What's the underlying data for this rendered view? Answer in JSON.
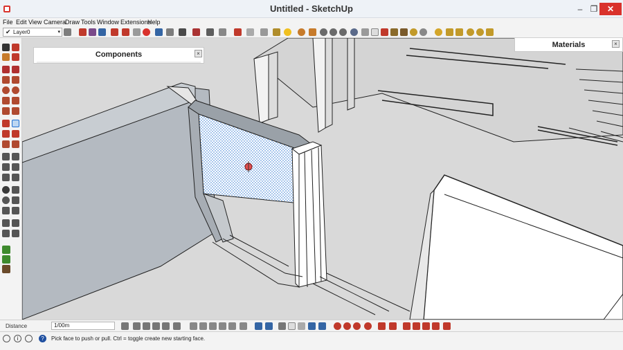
{
  "window": {
    "title": "Untitled - SketchUp",
    "minimize": "–",
    "maximize": "❐",
    "close": "✕"
  },
  "menu": [
    "File",
    "Edit",
    "View",
    "Camera",
    "Draw",
    "Tools",
    "Window",
    "Extensions",
    "Help"
  ],
  "layer": {
    "check": "✔",
    "value": "Layer0",
    "arrow": "▾"
  },
  "panels": {
    "components": {
      "title": "Components",
      "close": "×"
    },
    "materials": {
      "title": "Materials",
      "close": "×"
    }
  },
  "measurements": {
    "label": "Distance",
    "value": "1/00m"
  },
  "status": {
    "text": "Pick face to push or pull. Ctrl = toggle create new starting face.",
    "help": "?",
    "info": "i"
  },
  "colors": {
    "accent": "#d9322c",
    "selection_blue": "#1f6fd1",
    "wall": "#b4bac1",
    "floor": "#d9d9d9"
  },
  "icons": {
    "main_toolbar": [
      "tape-icon",
      "paint-icon",
      "eraser-icon",
      "undo-icon",
      "redo-icon",
      "push-pull-icon",
      "move-icon",
      "rotate-icon",
      "scale-icon",
      "orbit-icon",
      "zoom-icon"
    ],
    "left_toolbar": [
      "select-icon",
      "line-icon",
      "rectangle-icon",
      "circle-icon",
      "arc-icon",
      "move-icon",
      "push-pull-icon",
      "rotate-icon",
      "follow-me-icon",
      "offset-icon",
      "tape-icon",
      "text-icon",
      "orbit-icon",
      "pan-icon",
      "zoom-icon",
      "walk-icon",
      "plant-icon"
    ],
    "status": [
      "info-icon",
      "credit-icon",
      "user-icon",
      "help-icon"
    ]
  }
}
